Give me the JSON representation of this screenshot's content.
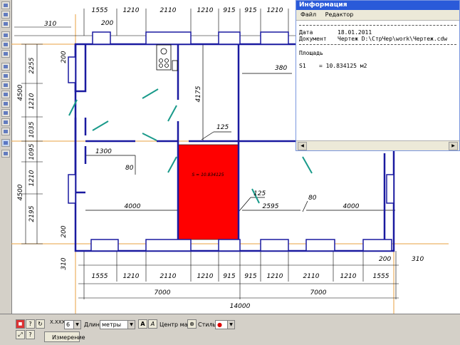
{
  "plan": {
    "top_dims": [
      "1555",
      "1210",
      "2110",
      "1210",
      "915",
      "915",
      "1210",
      "2110",
      "1210",
      "1555"
    ],
    "bottom_dims": [
      "1555",
      "1210",
      "2110",
      "1210",
      "915",
      "915",
      "1210",
      "2110",
      "1210",
      "1555"
    ],
    "total_half_left": "7000",
    "total_half_right": "7000",
    "total": "14000",
    "left_dims": [
      "2255",
      "1210",
      "1035",
      "1095",
      "1210",
      "2195"
    ],
    "left_totals": [
      "4500",
      "4500"
    ],
    "corner_top": "310",
    "corner_top_inner": "200",
    "corner_left": "200",
    "corner_bottom_left": "200",
    "corner_bottom_left_outer": "310",
    "corner_br_inner": "200",
    "corner_br_outer": "310",
    "dim_4175": "4175",
    "dim_380": "380",
    "dim_125_top": "125",
    "dim_125_mid": "125",
    "dim_1300": "1300",
    "dim_80_left": "80",
    "dim_80_right": "80",
    "dim_4000_left": "4000",
    "dim_2595": "2595",
    "dim_4000_right": "4000",
    "area_label": "S = 10.834125",
    "highlight_color": "#ff0000",
    "wall_color": "#1a1aa0",
    "door_color": "#199a8a",
    "axis_color": "#e8a040"
  },
  "info": {
    "title": "Информация",
    "menu": [
      "Файл",
      "Редактор"
    ],
    "date_label": "Дата",
    "date_value": "18.01.2011",
    "doc_label": "Документ",
    "doc_value": "Чертеж D:\\СтрЧер\\work\\Чертеж.cdw",
    "area_heading": "Площадь",
    "s1_label": "S1",
    "s1_value": "= 10.834125 м2"
  },
  "bottom": {
    "precision_value": "6",
    "length_label": "Длина",
    "units_value": "метры",
    "center_label": "Центр масс",
    "style_label": "Стиль",
    "tab_label": "Измерение",
    "precision_prefix": "X.XXX"
  }
}
